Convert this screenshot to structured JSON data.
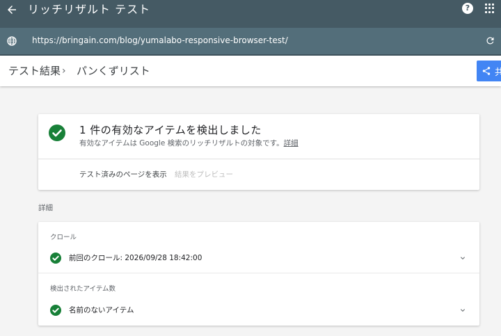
{
  "appbar": {
    "back_icon": "arrow-back-icon",
    "title": "リッチリザルト テスト",
    "help_icon": "help-icon",
    "help_glyph": "?",
    "apps_icon": "apps-grid-icon"
  },
  "urlbar": {
    "globe_icon": "globe-icon",
    "url": "https://bringain.com/blog/yumalabo-responsive-browser-test/",
    "refresh_icon": "refresh-icon"
  },
  "breadcrumb": {
    "item1": "テスト結果",
    "separator": "›",
    "item2": "パンくずリスト"
  },
  "share": {
    "icon": "share-icon",
    "label": "共"
  },
  "summary": {
    "headline": "1 件の有効なアイテムを検出しました",
    "description": "有効なアイテムは Google 検索のリッチリザルトの対象です。",
    "details_link": "詳細",
    "tab_tested_page": "テスト済みのページを表示",
    "tab_preview": "結果をプレビュー"
  },
  "details": {
    "section_title": "詳細",
    "crawl_label": "クロール",
    "crawl_value": "前回のクロール: 2026/09/28 18:42:00",
    "items_label": "検出されたアイテム数",
    "items_value": "名前のないアイテム"
  },
  "colors": {
    "appbar": "#455a64",
    "urlbar": "#536e7a",
    "success": "#188038",
    "primary": "#4285f4"
  }
}
